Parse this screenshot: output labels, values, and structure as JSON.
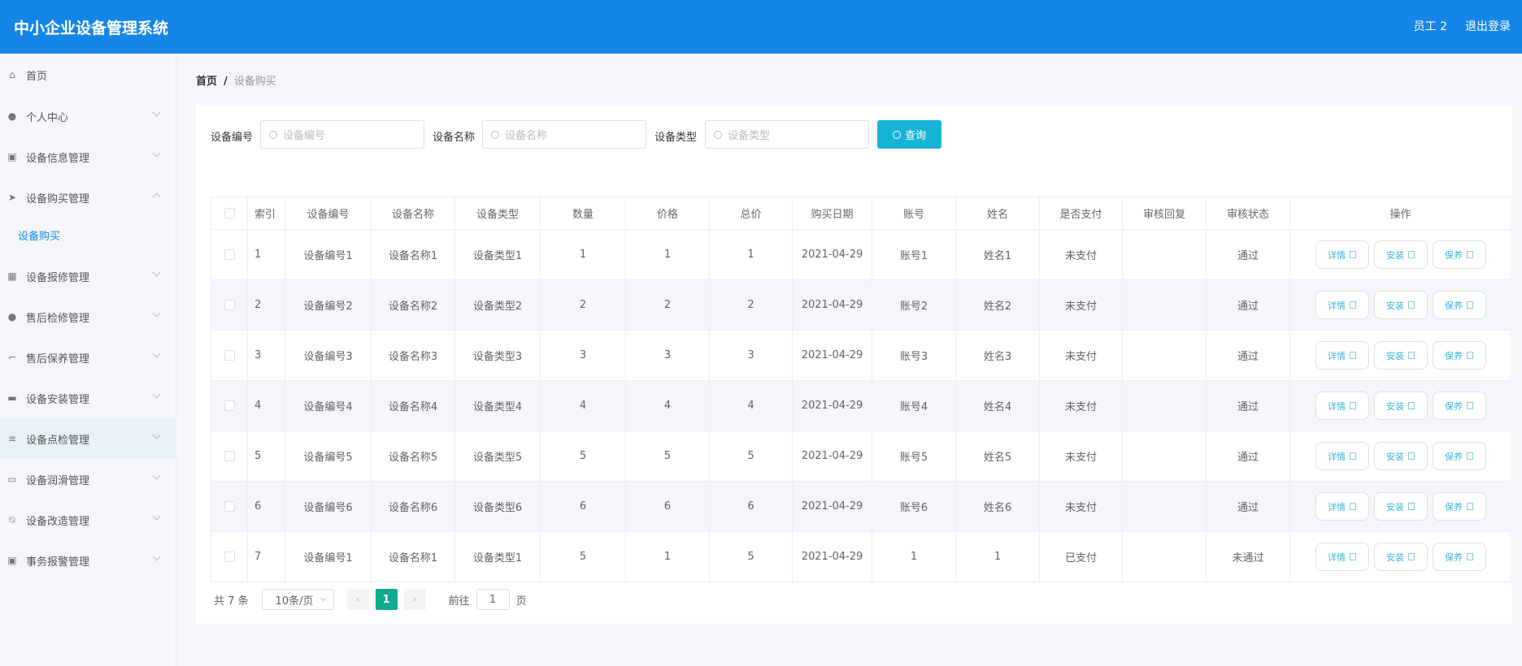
{
  "header": {
    "title": "中小企业设备管理系统",
    "user": "员工 2",
    "logout": "退出登录"
  },
  "sidebar": {
    "items": [
      {
        "label": "首页",
        "icon": "home-icon"
      },
      {
        "label": "个人中心",
        "icon": "user-icon"
      },
      {
        "label": "设备信息管理",
        "icon": "clipboard-icon"
      },
      {
        "label": "设备购买管理",
        "icon": "send-icon"
      },
      {
        "label": "设备购买",
        "icon": ""
      },
      {
        "label": "设备报修管理",
        "icon": "grid-icon"
      },
      {
        "label": "售后检修管理",
        "icon": "user-icon"
      },
      {
        "label": "售后保养管理",
        "icon": "crop-icon"
      },
      {
        "label": "设备安装管理",
        "icon": "briefcase-icon"
      },
      {
        "label": "设备点检管理",
        "icon": "list-icon"
      },
      {
        "label": "设备润滑管理",
        "icon": "message-icon"
      },
      {
        "label": "设备改造管理",
        "icon": "bell-off-icon"
      },
      {
        "label": "事务报警管理",
        "icon": "clipboard-x-icon"
      }
    ]
  },
  "breadcrumb": {
    "home": "首页",
    "sep": "/",
    "current": "设备购买"
  },
  "search": {
    "f1": {
      "label": "设备编号",
      "placeholder": "设备编号"
    },
    "f2": {
      "label": "设备名称",
      "placeholder": "设备名称"
    },
    "f3": {
      "label": "设备类型",
      "placeholder": "设备类型"
    },
    "button": "查询"
  },
  "table": {
    "headers": [
      "索引",
      "设备编号",
      "设备名称",
      "设备类型",
      "数量",
      "价格",
      "总价",
      "购买日期",
      "账号",
      "姓名",
      "是否支付",
      "审核回复",
      "审核状态",
      "操作"
    ],
    "rows": [
      [
        "1",
        "设备编号1",
        "设备名称1",
        "设备类型1",
        "1",
        "1",
        "1",
        "2021-04-29",
        "账号1",
        "姓名1",
        "未支付",
        "",
        "通过"
      ],
      [
        "2",
        "设备编号2",
        "设备名称2",
        "设备类型2",
        "2",
        "2",
        "2",
        "2021-04-29",
        "账号2",
        "姓名2",
        "未支付",
        "",
        "通过"
      ],
      [
        "3",
        "设备编号3",
        "设备名称3",
        "设备类型3",
        "3",
        "3",
        "3",
        "2021-04-29",
        "账号3",
        "姓名3",
        "未支付",
        "",
        "通过"
      ],
      [
        "4",
        "设备编号4",
        "设备名称4",
        "设备类型4",
        "4",
        "4",
        "4",
        "2021-04-29",
        "账号4",
        "姓名4",
        "未支付",
        "",
        "通过"
      ],
      [
        "5",
        "设备编号5",
        "设备名称5",
        "设备类型5",
        "5",
        "5",
        "5",
        "2021-04-29",
        "账号5",
        "姓名5",
        "未支付",
        "",
        "通过"
      ],
      [
        "6",
        "设备编号6",
        "设备名称6",
        "设备类型6",
        "6",
        "6",
        "6",
        "2021-04-29",
        "账号6",
        "姓名6",
        "未支付",
        "",
        "通过"
      ],
      [
        "7",
        "设备编号1",
        "设备名称1",
        "设备类型1",
        "5",
        "1",
        "5",
        "2021-04-29",
        "1",
        "1",
        "已支付",
        "",
        "未通过"
      ]
    ],
    "actions": [
      "详情",
      "安装",
      "保养"
    ]
  },
  "pagination": {
    "total": "共 7 条",
    "page_size": "10条/页",
    "prev": "‹",
    "current": "1",
    "next": "›",
    "goto_label": "前往",
    "goto_value": "1",
    "page_suffix": "页"
  }
}
